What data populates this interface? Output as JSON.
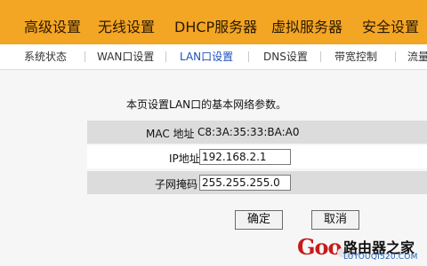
{
  "top_nav": [
    {
      "label": "高级设置"
    },
    {
      "label": "无线设置"
    },
    {
      "label": "DHCP服务器"
    },
    {
      "label": "虚拟服务器"
    },
    {
      "label": "安全设置"
    }
  ],
  "sub_nav": [
    {
      "label": "系统状态"
    },
    {
      "label": "WAN口设置"
    },
    {
      "label": "LAN口设置",
      "active": true
    },
    {
      "label": "DNS设置"
    },
    {
      "label": "带宽控制"
    },
    {
      "label": "流量"
    }
  ],
  "page": {
    "description": "本页设置LAN口的基本网络参数。"
  },
  "form": {
    "mac_label": "MAC 地址",
    "mac_value": "C8:3A:35:33:BA:A0",
    "ip_label": "IP地址",
    "ip_value": "192.168.2.1",
    "mask_label": "子网掩码",
    "mask_value": "255.255.255.0"
  },
  "buttons": {
    "ok": "确定",
    "cancel": "取消"
  },
  "watermark": {
    "brand_text": "Goo",
    "brand_name": "路由器之家",
    "url": "LUYOUQI520.COM"
  },
  "colors": {
    "top_bar": "#f3a524",
    "active_subnav": "#1f4fbf",
    "gray_row": "#dcdcdc",
    "content_bg": "#f6f6f6"
  }
}
